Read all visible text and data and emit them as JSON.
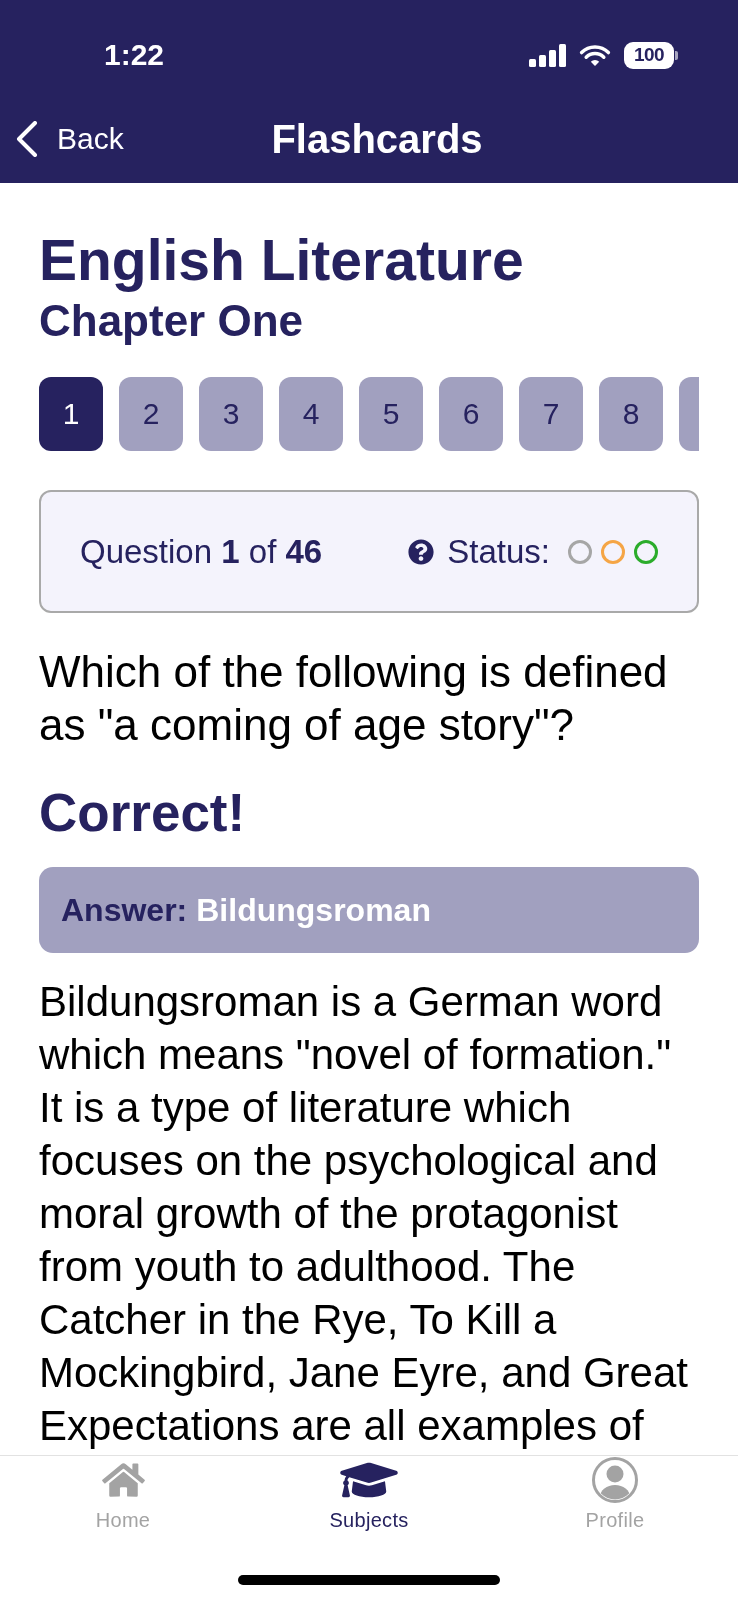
{
  "status_bar": {
    "time": "1:22",
    "battery": "100"
  },
  "nav_bar": {
    "back": "Back",
    "title": "Flashcards"
  },
  "subject": {
    "title": "English Literature",
    "chapter": "Chapter One"
  },
  "question_pager": [
    {
      "label": "1",
      "selected": true
    },
    {
      "label": "2",
      "selected": false
    },
    {
      "label": "3",
      "selected": false
    },
    {
      "label": "4",
      "selected": false
    },
    {
      "label": "5",
      "selected": false
    },
    {
      "label": "6",
      "selected": false
    },
    {
      "label": "7",
      "selected": false
    },
    {
      "label": "8",
      "selected": false
    },
    {
      "selected": false
    }
  ],
  "progress": {
    "text": "Question **1** of **46**",
    "status_label": "Status:",
    "indicators": [
      {
        "color": "#a6a6a6"
      },
      {
        "color": "#f5a545"
      },
      {
        "color": "#2bac2b"
      }
    ]
  },
  "question": "Which of the following is defined as \"a coming of age story\"?",
  "result": "Correct!",
  "answer": {
    "label": "Answer:",
    "value": "Bildungsroman"
  },
  "explanation": "Bildungsroman is a German word which means \"novel of formation.\" It is a type of literature which focuses on the psychological and moral growth of the protagonist from youth to adulthood. The Catcher in the Rye, To Kill a Mockingbird, Jane Eyre, and Great Expectations are all examples of",
  "tab_bar": [
    {
      "label": "Home",
      "selected": false
    },
    {
      "label": "Subjects",
      "selected": true
    },
    {
      "label": "Profile",
      "selected": false
    }
  ]
}
